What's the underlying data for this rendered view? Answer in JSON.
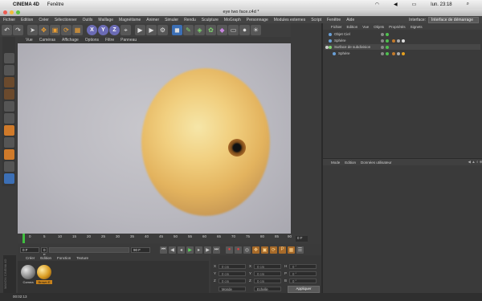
{
  "mac_menu": {
    "app": "CINEMA 4D",
    "item": "Fenêtre",
    "clock": "lun. 23:18"
  },
  "window": {
    "title": "eye two face.c4d *"
  },
  "menubar": {
    "items": [
      "Fichier",
      "Edition",
      "Créer",
      "Sélectionner",
      "Outils",
      "Maillage",
      "Magnétisme",
      "Animer",
      "Simuler",
      "Rendu",
      "Sculpture",
      "MoGraph",
      "Personnage",
      "Modules externes",
      "Script",
      "Fenêtre",
      "Aide"
    ],
    "layout_label": "Interface:",
    "layout_value": "Interface de démarrage"
  },
  "toolbar": {
    "axis_x": "X",
    "axis_y": "Y",
    "axis_z": "Z"
  },
  "viewport": {
    "menu": [
      "Vue",
      "Caméras",
      "Affichage",
      "Options",
      "Filtre",
      "Panneau"
    ]
  },
  "timeline": {
    "ticks": [
      "0",
      "5",
      "10",
      "15",
      "20",
      "25",
      "30",
      "35",
      "40",
      "45",
      "50",
      "55",
      "60",
      "65",
      "70",
      "75",
      "80",
      "85",
      "90"
    ],
    "frame": "0 F"
  },
  "transport": {
    "start": "0 F",
    "current": "0 F",
    "end": "90 F"
  },
  "material_manager": {
    "menu": [
      "Créer",
      "Edition",
      "Fonction",
      "Texture"
    ],
    "materials": [
      {
        "name": "Cornea"
      },
      {
        "name": "Brown E"
      }
    ],
    "brand": "MAXON CINEMA 4D"
  },
  "coordinates": {
    "rows": [
      {
        "axis": "X",
        "pos": "0 cm",
        "size": "0 cm",
        "rot_label": "H",
        "rot": "0 °"
      },
      {
        "axis": "Y",
        "pos": "0 cm",
        "size": "0 cm",
        "rot_label": "P",
        "rot": "0 °"
      },
      {
        "axis": "Z",
        "pos": "0 cm",
        "size": "0 cm",
        "rot_label": "B",
        "rot": "0 °"
      }
    ],
    "mode_a": "Monde",
    "mode_b": "Echelle",
    "apply": "Appliquer"
  },
  "object_manager": {
    "menu": [
      "Fichier",
      "Edition",
      "Vue",
      "Objets",
      "Propriétés",
      "Signets"
    ],
    "objects": [
      {
        "name": "Objet Ciel"
      },
      {
        "name": "Sphère"
      },
      {
        "name": "Surface de subdivision"
      },
      {
        "name": "Sphère"
      }
    ]
  },
  "attribute_manager": {
    "menu": [
      "Mode",
      "Edition",
      "Données utilisateur"
    ]
  },
  "status": {
    "time": "00:02:13"
  },
  "colors": {
    "accent_green": "#3fbf3f",
    "eye_yellow": "#f1cf7f",
    "iris_brown": "#7a4a1a"
  }
}
